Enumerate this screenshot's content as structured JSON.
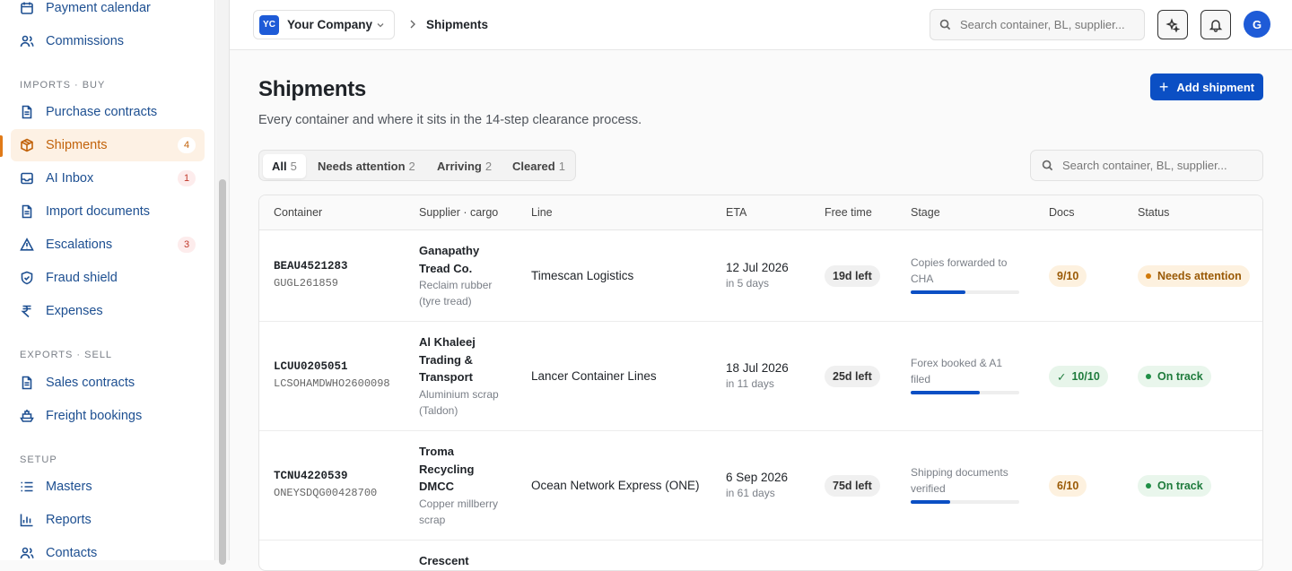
{
  "sidebar": {
    "items_top": [
      {
        "label": "Payment calendar",
        "icon": "calendar-icon"
      },
      {
        "label": "Commissions",
        "icon": "users-icon"
      }
    ],
    "sections": [
      {
        "label": "IMPORTS · BUY"
      },
      {
        "label": "EXPORTS · SELL"
      },
      {
        "label": "SETUP"
      }
    ],
    "imports": [
      {
        "label": "Purchase contracts",
        "icon": "document-icon"
      },
      {
        "label": "Shipments",
        "icon": "box-icon",
        "badge": "4"
      },
      {
        "label": "AI Inbox",
        "icon": "inbox-icon",
        "badge": "1"
      },
      {
        "label": "Import documents",
        "icon": "document-icon"
      },
      {
        "label": "Escalations",
        "icon": "warning-icon",
        "badge": "3"
      },
      {
        "label": "Fraud shield",
        "icon": "shield-icon"
      },
      {
        "label": "Expenses",
        "icon": "rupee-icon"
      }
    ],
    "exports": [
      {
        "label": "Sales contracts",
        "icon": "document-icon"
      },
      {
        "label": "Freight bookings",
        "icon": "ship-icon"
      }
    ],
    "setup": [
      {
        "label": "Masters",
        "icon": "list-icon"
      },
      {
        "label": "Reports",
        "icon": "chart-icon"
      },
      {
        "label": "Contacts",
        "icon": "users-icon"
      }
    ]
  },
  "topbar": {
    "company_initials": "YC",
    "company_name": "Your Company",
    "breadcrumb": "Shipments",
    "search_placeholder": "Search container, BL, supplier...",
    "avatar_initial": "G"
  },
  "main": {
    "title": "Shipments",
    "subtitle": "Every container and where it sits in the 14-step clearance process.",
    "add_label": "Add shipment",
    "tabs": [
      {
        "label": "All",
        "count": "5"
      },
      {
        "label": "Needs attention",
        "count": "2"
      },
      {
        "label": "Arriving",
        "count": "2"
      },
      {
        "label": "Cleared",
        "count": "1"
      }
    ],
    "search_placeholder": "Search container, BL, supplier..."
  },
  "table": {
    "headers": [
      "Container",
      "Supplier · cargo",
      "Line",
      "ETA",
      "Free time",
      "Stage",
      "Docs",
      "Status"
    ],
    "rows": [
      {
        "container": "BEAU4521283",
        "bl": "GUGL261859",
        "supplier": "Ganapathy Tread Co.",
        "cargo": "Reclaim rubber (tyre tread)",
        "line": "Timescan Logistics",
        "eta": "12 Jul 2026",
        "eta_sub": "in 5 days",
        "free_time": "19d left",
        "stage": "Copies forwarded to CHA",
        "stage_progress": 0.5,
        "docs": "9/10",
        "status": "Needs attention"
      },
      {
        "container": "LCUU0205051",
        "bl": "LCSOHAMDWHO2600098",
        "supplier": "Al Khaleej Trading & Transport",
        "cargo": "Aluminium scrap (Taldon)",
        "line": "Lancer Container Lines",
        "eta": "18 Jul 2026",
        "eta_sub": "in 11 days",
        "free_time": "25d left",
        "stage": "Forex booked & A1 filed",
        "stage_progress": 0.64,
        "docs": "10/10",
        "status": "On track"
      },
      {
        "container": "TCNU4220539",
        "bl": "ONEYSDQG00428700",
        "supplier": "Troma Recycling DMCC",
        "cargo": "Copper millberry scrap",
        "line": "Ocean Network Express (ONE)",
        "eta": "6 Sep 2026",
        "eta_sub": "in 61 days",
        "free_time": "75d left",
        "stage": "Shipping documents verified",
        "stage_progress": 0.36,
        "docs": "6/10",
        "status": "On track"
      },
      {
        "supplier": "Crescent"
      }
    ]
  }
}
